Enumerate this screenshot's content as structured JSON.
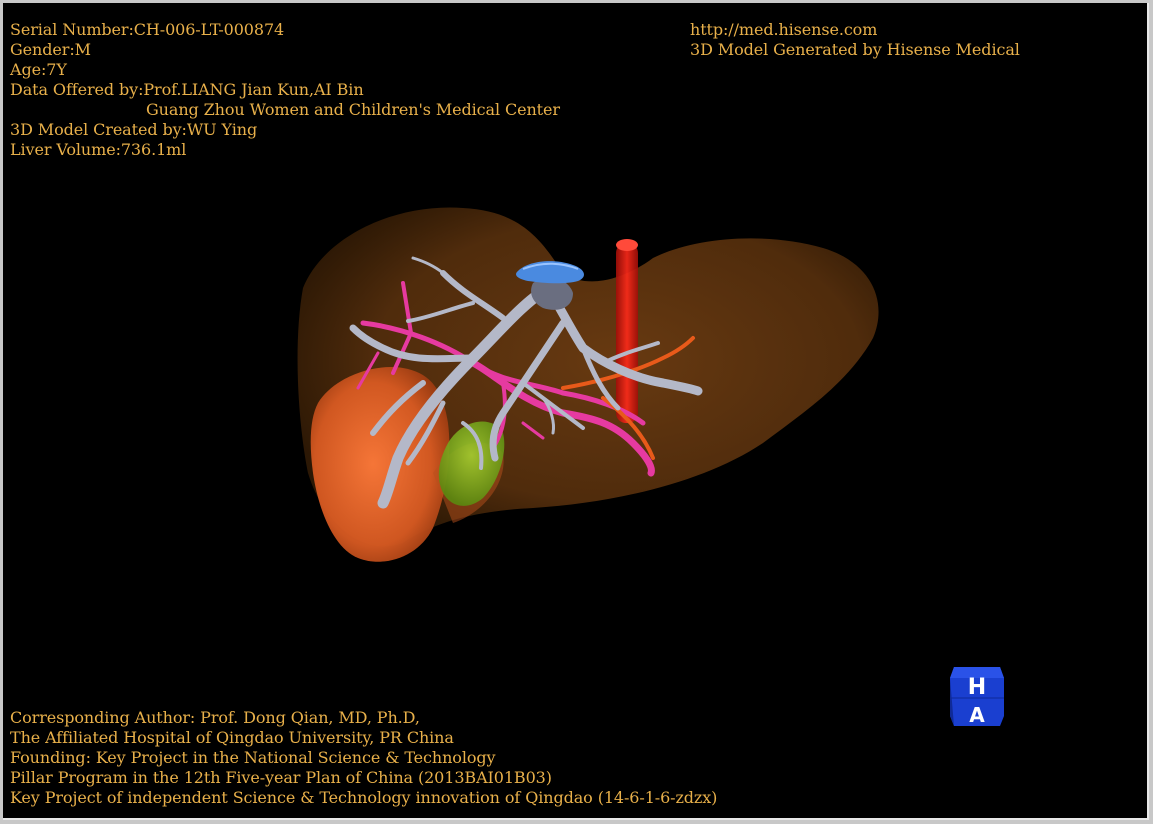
{
  "info_top_left": {
    "serial": "Serial Number:CH-006-LT-000874",
    "gender": "Gender:M",
    "age": "Age:7Y",
    "data_offered": "Data Offered by:Prof.LIANG Jian Kun,AI Bin",
    "data_offered_2": "Guang Zhou Women and Children's Medical Center",
    "model_created": "3D Model Created by:WU Ying",
    "liver_volume": "Liver Volume:736.1ml"
  },
  "info_top_right": {
    "url": "http://med.hisense.com",
    "generated_by": "3D Model Generated by Hisense Medical"
  },
  "info_bottom_left": {
    "author": "Corresponding Author: Prof. Dong Qian, MD, Ph.D,",
    "hospital": "The Affiliated Hospital of Qingdao University, PR China",
    "founding": "Founding: Key Project in the National Science & Technology",
    "program": "Pillar Program in the 12th Five-year Plan of China (2013BAI01B03)",
    "project": "Key Project of independent Science & Technology innovation of Qingdao (14-6-1-6-zdzx)"
  },
  "orientation_cube": {
    "top_letter": "H",
    "bottom_letter": "A",
    "color": "#1a3fd0"
  },
  "colors": {
    "text": "#e8b04a",
    "liver": "#8a4a14",
    "right_lobe": "#e0642a",
    "portal_vein": "#b8bccb",
    "hepatic_artery": "#e63aa0",
    "ivc": "#d91a10",
    "gallbladder": "#7fb420",
    "bile_duct_top": "#4a8ae0"
  }
}
